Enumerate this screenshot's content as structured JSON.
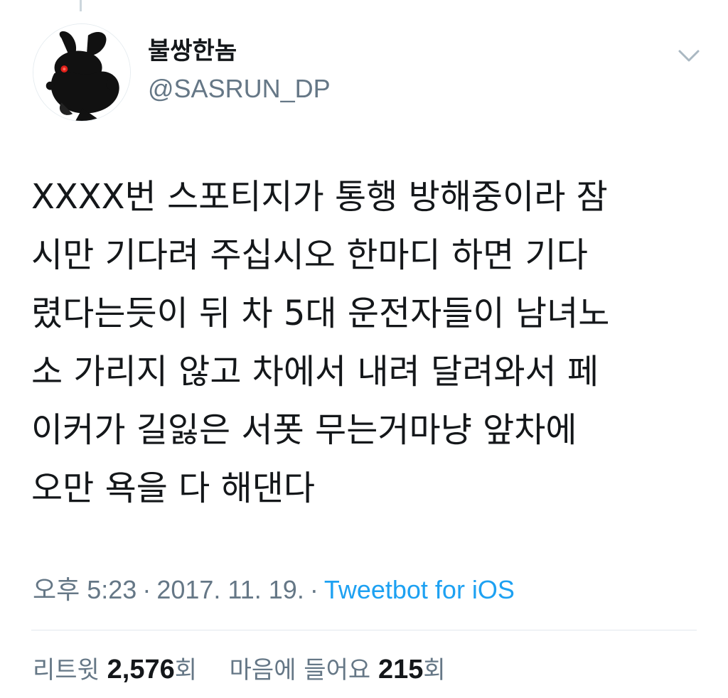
{
  "user": {
    "display_name": "불쌍한놈",
    "handle": "@SASRUN_DP",
    "avatar_icon": "rabbit-silhouette-avatar"
  },
  "menu": {
    "caret_icon": "chevron-down-icon"
  },
  "tweet": {
    "lines": [
      "XXXX번 스포티지가 통행 방해중이라 잠",
      "시만 기다려 주십시오 한마디 하면 기다",
      "렸다는듯이 뒤 차 5대 운전자들이 남녀노",
      "소 가리지 않고 차에서 내려 달려와서 페",
      "이커가 길잃은 서폿 무는거마냥 앞차에",
      "오만 욕을 다 해댄다"
    ]
  },
  "meta": {
    "time": "오후 5:23",
    "separator": "·",
    "date": "2017. 11. 19.",
    "client": "Tweetbot for iOS"
  },
  "stats": {
    "retweets_label": "리트윗",
    "retweets_count": "2,576",
    "retweets_suffix": "회",
    "likes_label": "마음에 들어요",
    "likes_count": "215",
    "likes_suffix": "회"
  },
  "colors": {
    "text": "#14171a",
    "secondary": "#657786",
    "link": "#1da1f2",
    "divider": "#e1e8ed"
  }
}
